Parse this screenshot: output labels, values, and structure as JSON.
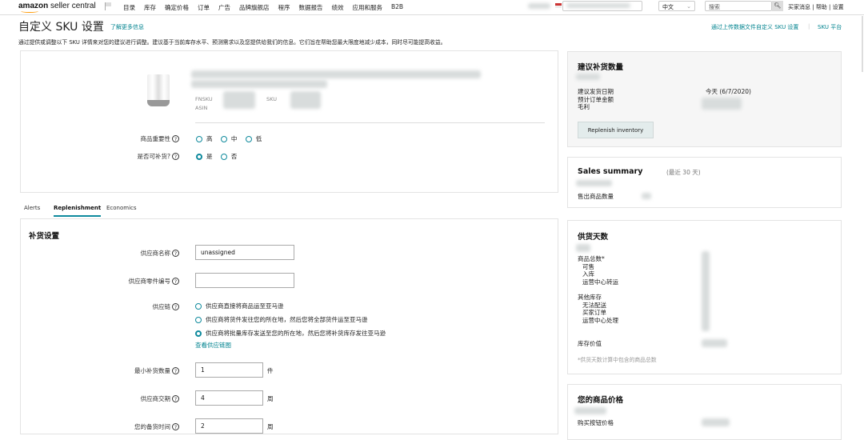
{
  "nav": {
    "logo_brand": "amazon",
    "logo_rest": "seller central",
    "menu": [
      "目录",
      "库存",
      "确定价格",
      "订单",
      "广告",
      "品牌旗舰店",
      "程序",
      "数据报告",
      "绩效",
      "应用和服务",
      "B2B"
    ],
    "language": "中文",
    "search_placeholder": "搜索",
    "links": [
      "买家消息",
      "帮助",
      "设置"
    ]
  },
  "header": {
    "title": "自定义 SKU 设置",
    "learn_more": "了解更多信息",
    "upload_link": "通过上传数据文件自定义 SKU 设置",
    "sku_platform": "SKU 平台",
    "description": "通过提供或调整以下 SKU 详情来对您的建议进行调整。建议基于当前库存水平、预测需求以及您提供给我们的信息。它们旨在帮助您最大限度地减少成本，同时尽可能提高收益。"
  },
  "product": {
    "fnsku_label": "FNSKU",
    "sku_label": "SKU",
    "asin_label": "ASIN",
    "importance_label": "商品重要性",
    "importance_options": [
      "高",
      "中",
      "低"
    ],
    "replenishable_label": "是否可补货?",
    "replenishable_options": [
      "是",
      "否"
    ]
  },
  "tabs": [
    "Alerts",
    "Replenishment",
    "Economics"
  ],
  "replenishment": {
    "title": "补货设置",
    "supplier_name_label": "供应商名称",
    "supplier_name_value": "unassigned",
    "supplier_part_label": "供应商零件编号",
    "supplier_part_value": "",
    "supply_chain_label": "供应链",
    "supply_chain_options": [
      "供应商直接将商品运至亚马逊",
      "供应商将货件发往您的所在地，然后您将全部货件运至亚马逊",
      "供应商将批量库存发送至您的所在地，然后您将补货库存发往亚马逊"
    ],
    "supply_chain_link": "查看供应链图",
    "min_qty_label": "最小补货数量",
    "min_qty_value": "1",
    "min_qty_unit": "件",
    "lead_time_label": "供应商交期",
    "lead_time_value": "4",
    "lead_time_unit": "周",
    "prep_time_label": "您的备货时间",
    "prep_time_value": "2",
    "prep_time_unit": "周"
  },
  "suggest": {
    "title": "建议补货数量",
    "ship_date_label": "建议发货日期",
    "ship_date_value": "今天 (6/7/2020)",
    "order_amount_label": "预计订单金额",
    "margin_label": "毛利",
    "button": "Replenish inventory"
  },
  "sales": {
    "title": "Sales summary",
    "period": "(最近 30 天)",
    "units_label": "售出商品数量"
  },
  "supply": {
    "title": "供货天数",
    "total_label": "商品总数*",
    "sub1": [
      "可售",
      "入库",
      "运营中心转运"
    ],
    "other_label": "其他库存",
    "sub2": [
      "无法配送",
      "买家订单",
      "运营中心处理"
    ],
    "value_label": "库存价值",
    "note": "*供货天数计算中包含的商品总数"
  },
  "price": {
    "title": "您的商品价格",
    "buybox_label": "购买按钮价格"
  },
  "colors": {
    "accent": "#0f8a9d",
    "link": "#00838f"
  }
}
